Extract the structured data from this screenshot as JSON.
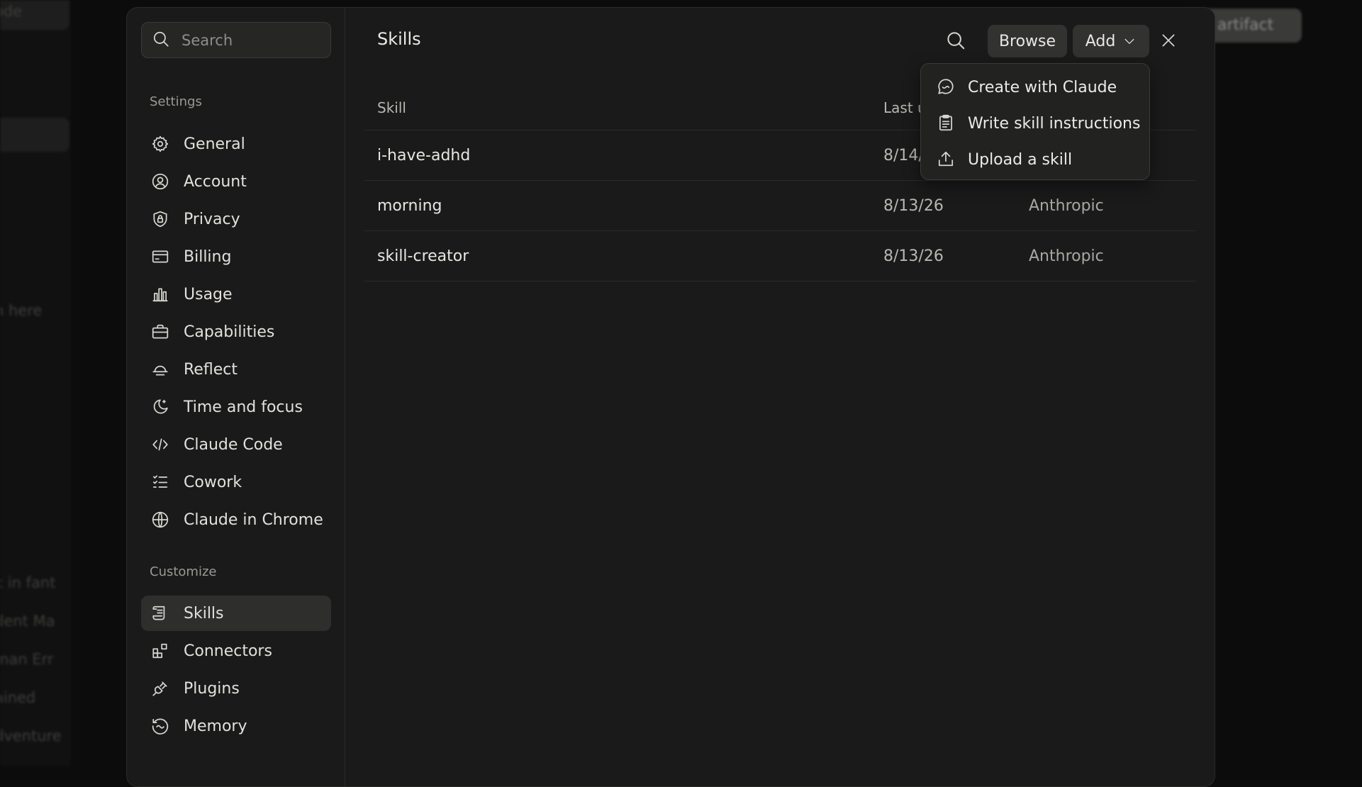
{
  "background": {
    "sidebar_texts": [
      "ode",
      "n here",
      "k in fant",
      "dent Ma",
      "man Err",
      "ained",
      "dventure"
    ],
    "artifact_button": "w artifact"
  },
  "nav": {
    "search_placeholder": "Search",
    "settings_heading": "Settings",
    "settings_items": [
      {
        "label": "General",
        "icon": "gear-icon"
      },
      {
        "label": "Account",
        "icon": "user-circle-icon"
      },
      {
        "label": "Privacy",
        "icon": "shield-lock-icon"
      },
      {
        "label": "Billing",
        "icon": "credit-card-icon"
      },
      {
        "label": "Usage",
        "icon": "bar-chart-icon"
      },
      {
        "label": "Capabilities",
        "icon": "toolbox-icon"
      },
      {
        "label": "Reflect",
        "icon": "sunset-icon"
      },
      {
        "label": "Time and focus",
        "icon": "moon-icon"
      },
      {
        "label": "Claude Code",
        "icon": "code-icon"
      },
      {
        "label": "Cowork",
        "icon": "checklist-icon"
      },
      {
        "label": "Claude in Chrome",
        "icon": "globe-icon"
      }
    ],
    "customize_heading": "Customize",
    "customize_items": [
      {
        "label": "Skills",
        "icon": "scroll-icon",
        "active": true
      },
      {
        "label": "Connectors",
        "icon": "blocks-icon"
      },
      {
        "label": "Plugins",
        "icon": "plug-icon"
      },
      {
        "label": "Memory",
        "icon": "memory-icon"
      }
    ]
  },
  "main": {
    "title": "Skills",
    "browse_label": "Browse",
    "add_label": "Add",
    "table": {
      "headers": {
        "skill": "Skill",
        "date": "Last u",
        "by": ""
      },
      "rows": [
        {
          "skill": "i-have-adhd",
          "date": "8/14/",
          "by": ""
        },
        {
          "skill": "morning",
          "date": "8/13/26",
          "by": "Anthropic"
        },
        {
          "skill": "skill-creator",
          "date": "8/13/26",
          "by": "Anthropic"
        }
      ]
    }
  },
  "dropdown": {
    "items": [
      {
        "label": "Create with Claude",
        "icon": "chat-bubble-icon"
      },
      {
        "label": "Write skill instructions",
        "icon": "clipboard-icon"
      },
      {
        "label": "Upload a skill",
        "icon": "upload-icon"
      }
    ]
  },
  "colors": {
    "modal_bg": "#1a1a1a",
    "active_item_bg": "#2e2e2d",
    "button_bg": "#323230",
    "text_primary": "#e6e4df",
    "text_muted": "#9b9994"
  }
}
